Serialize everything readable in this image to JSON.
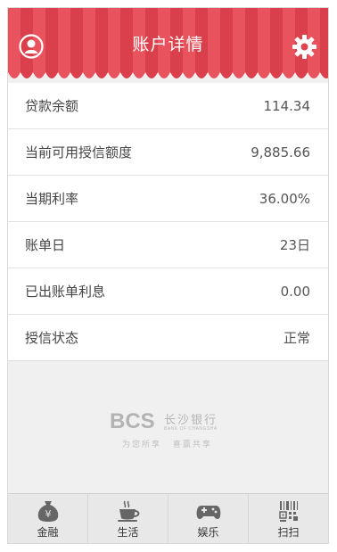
{
  "header": {
    "title": "账户详情",
    "left_icon": "user-profile-icon",
    "right_icon": "gear-icon",
    "accent": "#e24a55"
  },
  "details": [
    {
      "label": "贷款余额",
      "value": "114.34"
    },
    {
      "label": "当前可用授信额度",
      "value": "9,885.66"
    },
    {
      "label": "当期利率",
      "value": "36.00%"
    },
    {
      "label": "账单日",
      "value": "23日"
    },
    {
      "label": "已出账单利息",
      "value": "0.00"
    },
    {
      "label": "授信状态",
      "value": "正常"
    }
  ],
  "logo": {
    "letters": "BCS",
    "name": "长沙银行",
    "english": "BANK OF CHANGSHA",
    "slogan": "为您所享 喜赢共享"
  },
  "tabs": [
    {
      "label": "金融",
      "icon": "money-bag-icon"
    },
    {
      "label": "生活",
      "icon": "coffee-cup-icon"
    },
    {
      "label": "娱乐",
      "icon": "gamepad-icon"
    },
    {
      "label": "扫扫",
      "icon": "barcode-scan-icon"
    }
  ]
}
